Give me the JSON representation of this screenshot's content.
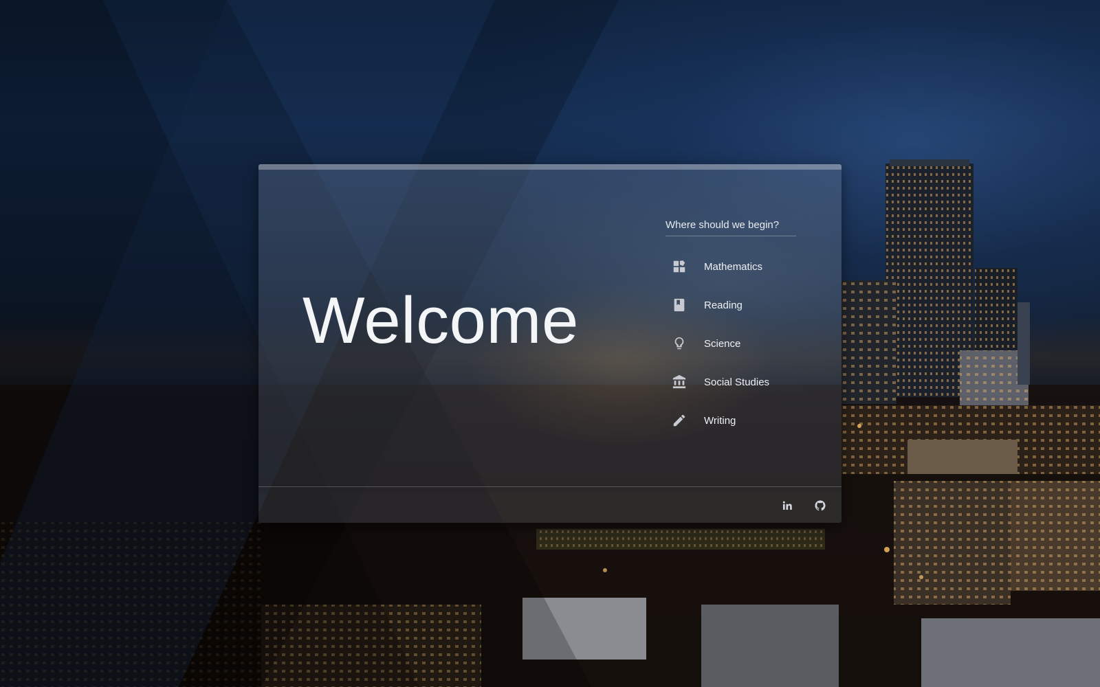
{
  "hero": {
    "title": "Welcome"
  },
  "menu": {
    "title": "Where should we begin?",
    "items": [
      {
        "label": "Mathematics",
        "icon": "widgets-icon"
      },
      {
        "label": "Reading",
        "icon": "book-icon"
      },
      {
        "label": "Science",
        "icon": "lightbulb-icon"
      },
      {
        "label": "Social Studies",
        "icon": "bank-icon"
      },
      {
        "label": "Writing",
        "icon": "pencil-icon"
      }
    ]
  },
  "footer": {
    "links": [
      {
        "icon": "linkedin-icon"
      },
      {
        "icon": "github-icon"
      }
    ]
  }
}
